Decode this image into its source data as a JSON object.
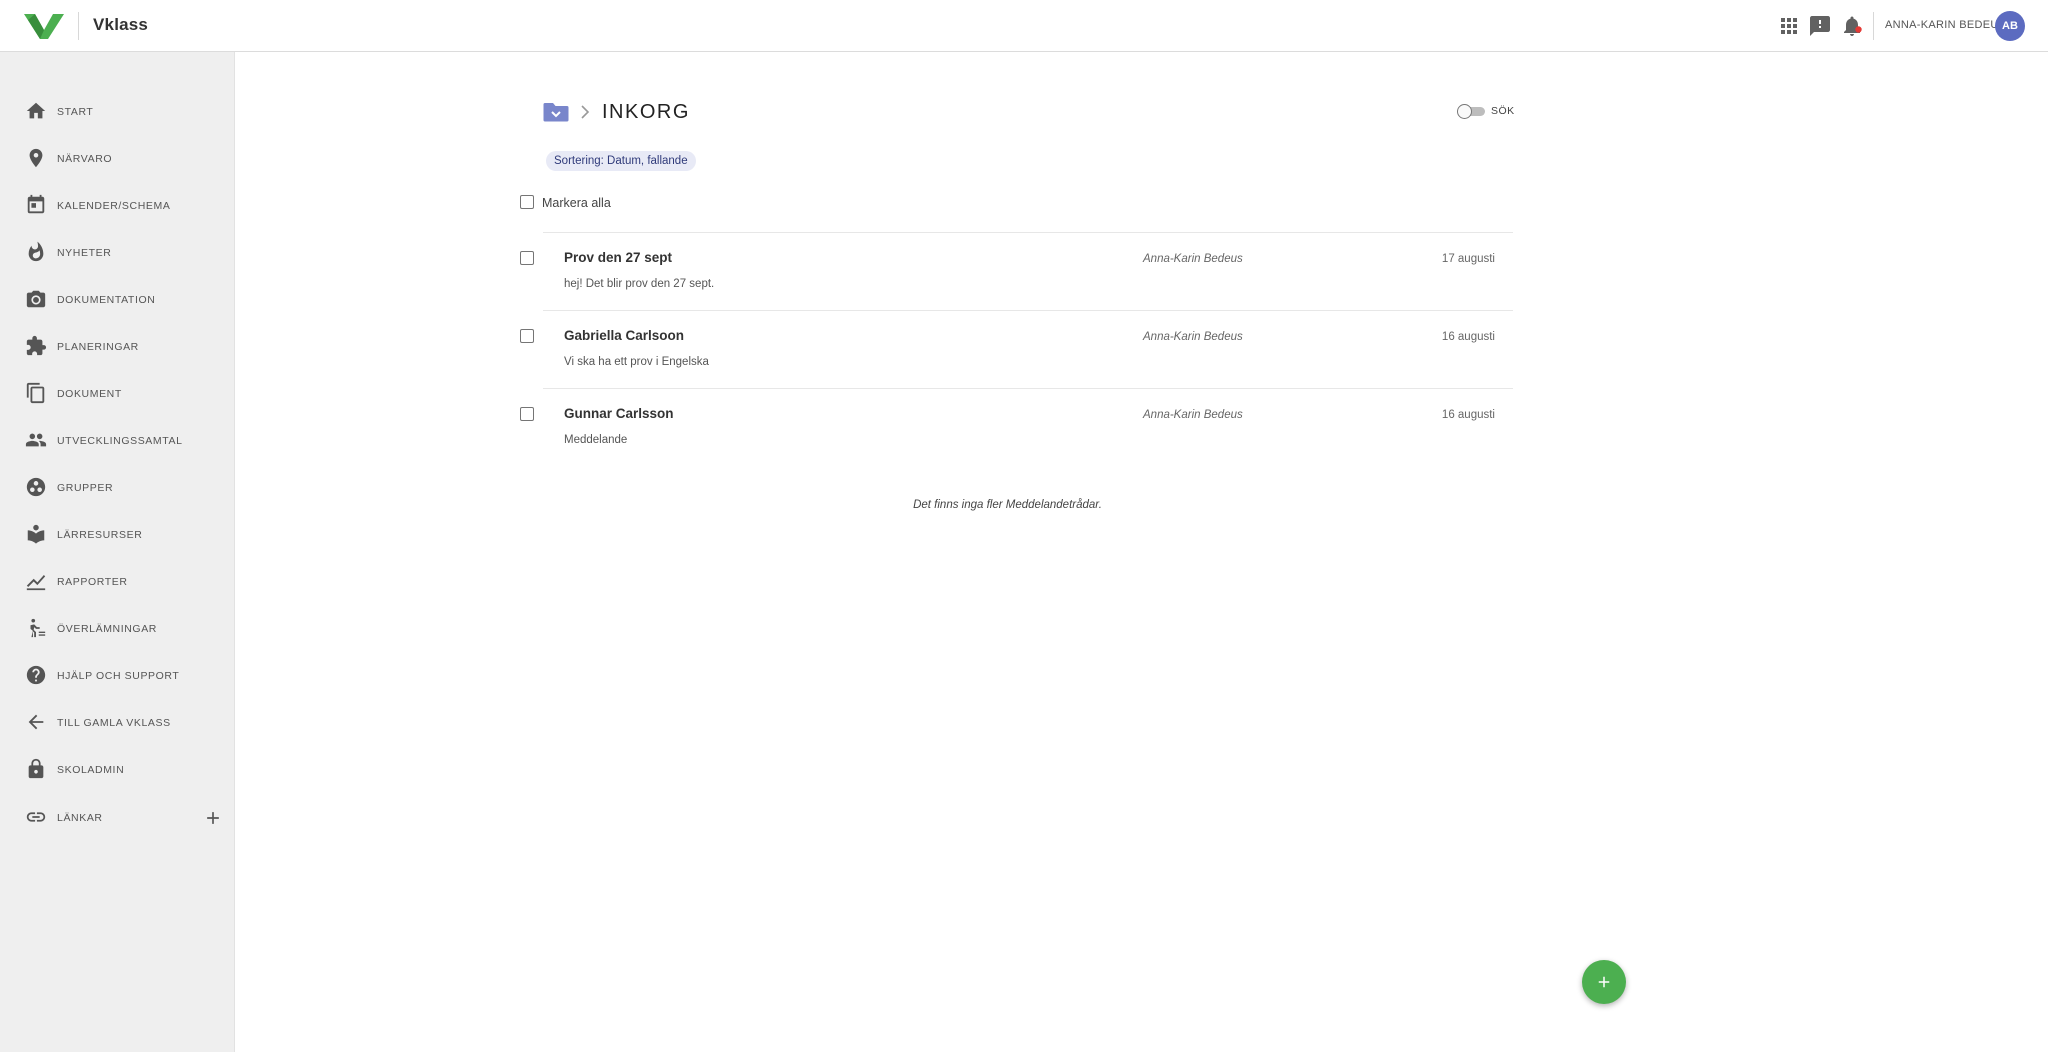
{
  "header": {
    "brand": "Vklass",
    "username": "ANNA-KARIN BEDEUS",
    "avatar_initials": "AB",
    "icons": [
      "apps-icon",
      "feedback-icon",
      "notifications-icon"
    ]
  },
  "colors": {
    "accent": "#5c6bc0",
    "brand_green": "#4caf50",
    "sidebar_bg": "#efefef",
    "chip_bg": "#e8eaf6"
  },
  "sidebar": {
    "items": [
      {
        "label": "START",
        "icon": "home-icon"
      },
      {
        "label": "NÄRVARO",
        "icon": "location-pin-icon"
      },
      {
        "label": "KALENDER/SCHEMA",
        "icon": "calendar-icon"
      },
      {
        "label": "NYHETER",
        "icon": "flame-icon"
      },
      {
        "label": "DOKUMENTATION",
        "icon": "camera-icon"
      },
      {
        "label": "PLANERINGAR",
        "icon": "puzzle-icon"
      },
      {
        "label": "DOKUMENT",
        "icon": "copy-icon"
      },
      {
        "label": "UTVECKLINGSSAMTAL",
        "icon": "people-icon"
      },
      {
        "label": "GRUPPER",
        "icon": "group-circle-icon"
      },
      {
        "label": "LÄRRESURSER",
        "icon": "book-icon"
      },
      {
        "label": "RAPPORTER",
        "icon": "chart-line-icon"
      },
      {
        "label": "ÖVERLÄMNINGAR",
        "icon": "handover-icon"
      },
      {
        "label": "HJÄLP OCH SUPPORT",
        "icon": "help-icon"
      },
      {
        "label": "TILL GAMLA VKLASS",
        "icon": "arrow-back-icon"
      },
      {
        "label": "SKOLADMIN",
        "icon": "lock-icon"
      },
      {
        "label": "LÄNKAR",
        "icon": "link-icon"
      }
    ]
  },
  "main": {
    "title": "INKORG",
    "search_label": "SÖK",
    "sort_chip": "Sortering: Datum, fallande",
    "select_all": "Markera alla",
    "messages": [
      {
        "subject": "Prov den 27 sept",
        "author": "Anna-Karin Bedeus",
        "date": "17 augusti",
        "preview": "hej! Det blir prov den 27 sept."
      },
      {
        "subject": "Gabriella Carlsoon",
        "author": "Anna-Karin Bedeus",
        "date": "16 augusti",
        "preview": "Vi ska ha ett prov i Engelska"
      },
      {
        "subject": "Gunnar Carlsson",
        "author": "Anna-Karin Bedeus",
        "date": "16 augusti",
        "preview": "Meddelande"
      }
    ],
    "no_more": "Det finns inga fler Meddelandetrådar."
  }
}
